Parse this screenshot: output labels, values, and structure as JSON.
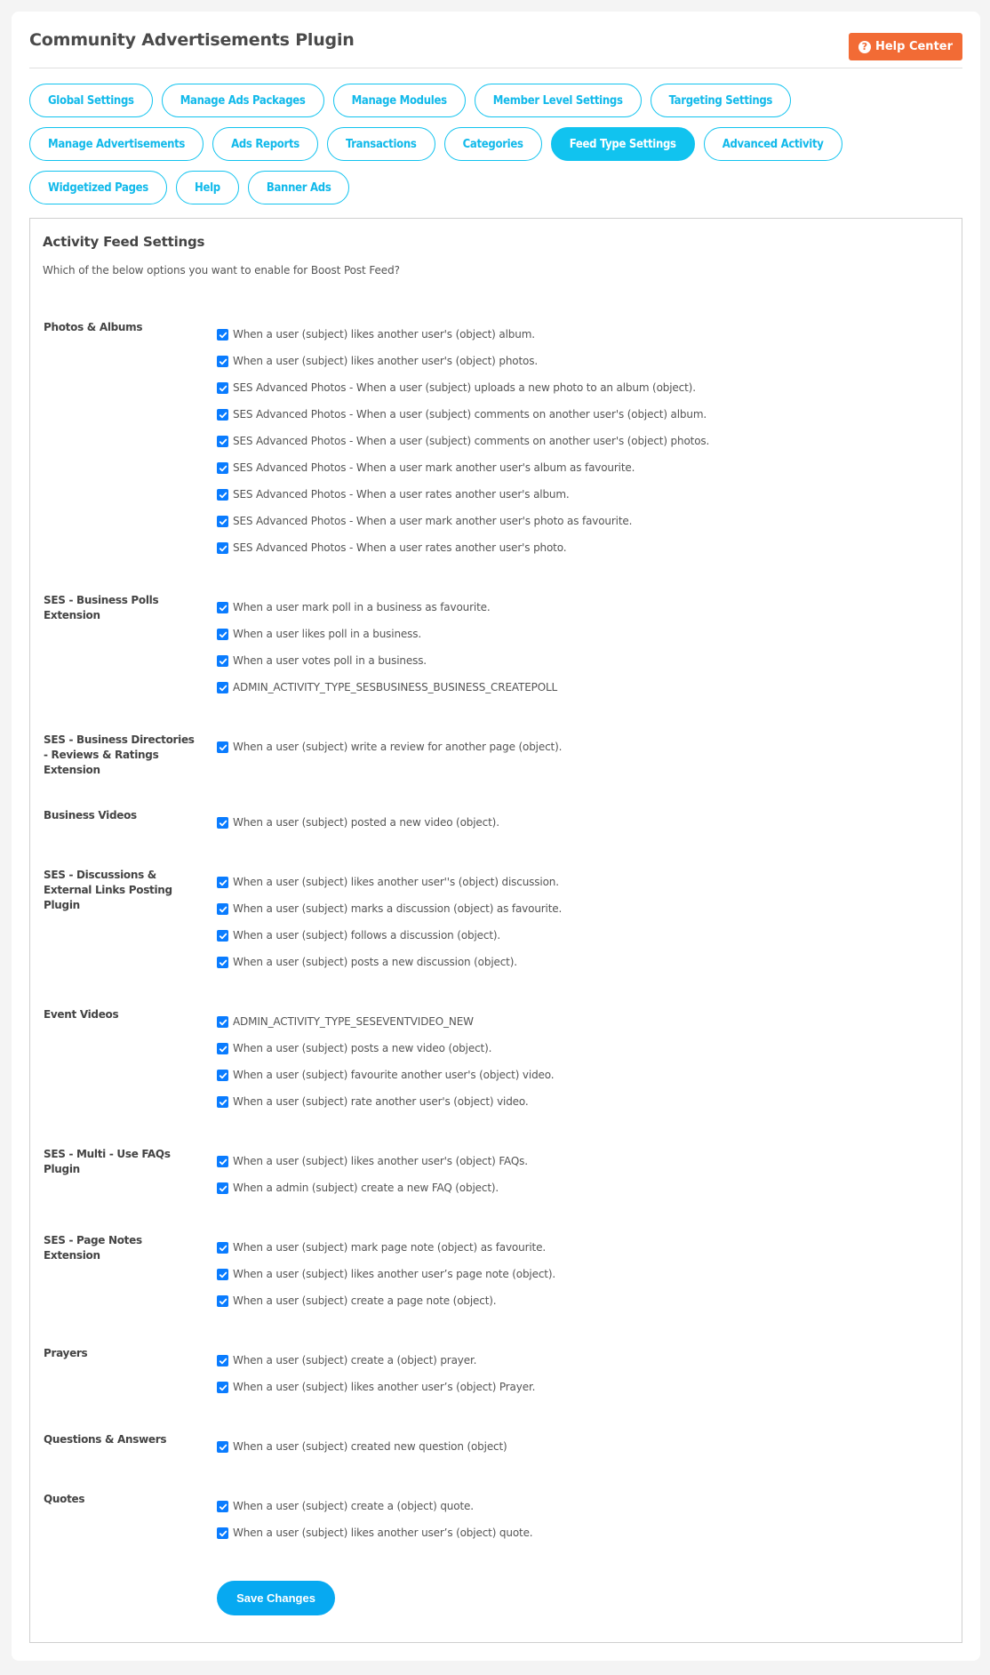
{
  "header": {
    "title": "Community Advertisements Plugin",
    "help_center_label": "Help Center",
    "help_icon": "question-circle-icon"
  },
  "colors": {
    "accent": "#11c3ef",
    "help_button": "#f26b35",
    "save_button": "#07a9f1",
    "checkbox": "#0a7cff"
  },
  "nav": {
    "active": "Feed Type Settings",
    "rows": [
      [
        "Global Settings",
        "Manage Ads Packages",
        "Manage Modules",
        "Member Level Settings",
        "Targeting Settings"
      ],
      [
        "Manage Advertisements",
        "Ads Reports",
        "Transactions",
        "Categories",
        "Feed Type Settings",
        "Advanced Activity"
      ],
      [
        "Widgetized Pages",
        "Help",
        "Banner Ads"
      ]
    ]
  },
  "settings": {
    "title": "Activity Feed Settings",
    "description": "Which of the below options you want to enable for Boost Post Feed?",
    "groups": [
      {
        "label": "Photos & Albums",
        "items": [
          {
            "label": "When a user (subject) likes another user's (object) album.",
            "checked": true
          },
          {
            "label": "When a user (subject) likes another user's (object) photos.",
            "checked": true
          },
          {
            "label": "SES Advanced Photos - When a user (subject) uploads a new photo to an album (object).",
            "checked": true
          },
          {
            "label": "SES Advanced Photos - When a user (subject) comments on another user's (object) album.",
            "checked": true
          },
          {
            "label": "SES Advanced Photos - When a user (subject) comments on another user's (object) photos.",
            "checked": true
          },
          {
            "label": "SES Advanced Photos - When a user mark another user's album as favourite.",
            "checked": true
          },
          {
            "label": "SES Advanced Photos - When a user rates another user's album.",
            "checked": true
          },
          {
            "label": "SES Advanced Photos - When a user mark another user's photo as favourite.",
            "checked": true
          },
          {
            "label": "SES Advanced Photos - When a user rates another user's photo.",
            "checked": true
          }
        ]
      },
      {
        "label": "SES - Business Polls Extension",
        "items": [
          {
            "label": "When a user mark poll in a business as favourite.",
            "checked": true
          },
          {
            "label": "When a user likes poll in a business.",
            "checked": true
          },
          {
            "label": "When a user votes poll in a business.",
            "checked": true
          },
          {
            "label": "ADMIN_ACTIVITY_TYPE_SESBUSINESS_BUSINESS_CREATEPOLL",
            "checked": true
          }
        ]
      },
      {
        "label": "SES - Business Directories - Reviews & Ratings Extension",
        "items": [
          {
            "label": "When a user (subject) write a review for another page (object).",
            "checked": true
          }
        ]
      },
      {
        "label": "Business Videos",
        "items": [
          {
            "label": "When a user (subject) posted a new video (object).",
            "checked": true
          }
        ]
      },
      {
        "label": "SES - Discussions & External Links Posting Plugin",
        "items": [
          {
            "label": "When a user (subject) likes another user''s (object) discussion.",
            "checked": true
          },
          {
            "label": "When a user (subject) marks a discussion (object) as favourite.",
            "checked": true
          },
          {
            "label": "When a user (subject) follows a discussion (object).",
            "checked": true
          },
          {
            "label": "When a user (subject) posts a new discussion (object).",
            "checked": true
          }
        ]
      },
      {
        "label": "Event Videos",
        "items": [
          {
            "label": "ADMIN_ACTIVITY_TYPE_SESEVENTVIDEO_NEW",
            "checked": true
          },
          {
            "label": "When a user (subject) posts a new video (object).",
            "checked": true
          },
          {
            "label": "When a user (subject) favourite another user's (object) video.",
            "checked": true
          },
          {
            "label": "When a user (subject) rate another user's (object) video.",
            "checked": true
          }
        ]
      },
      {
        "label": "SES - Multi - Use FAQs Plugin",
        "items": [
          {
            "label": "When a user (subject) likes another user's (object) FAQs.",
            "checked": true
          },
          {
            "label": "When a admin (subject) create a new FAQ (object).",
            "checked": true
          }
        ]
      },
      {
        "label": "SES - Page Notes Extension",
        "items": [
          {
            "label": "When a user (subject) mark page note (object) as favourite.",
            "checked": true
          },
          {
            "label": "When a user (subject) likes another user’s page note (object).",
            "checked": true
          },
          {
            "label": "When a user (subject) create a page note (object).",
            "checked": true
          }
        ]
      },
      {
        "label": "Prayers",
        "items": [
          {
            "label": "When a user (subject) create a (object) prayer.",
            "checked": true
          },
          {
            "label": "When a user (subject) likes another user’s (object) Prayer.",
            "checked": true
          }
        ]
      },
      {
        "label": "Questions & Answers",
        "items": [
          {
            "label": "When a user (subject) created new question (object)",
            "checked": true
          }
        ]
      },
      {
        "label": "Quotes",
        "items": [
          {
            "label": "When a user (subject) create a (object) quote.",
            "checked": true
          },
          {
            "label": "When a user (subject) likes another user’s (object) quote.",
            "checked": true
          }
        ]
      }
    ],
    "save_label": "Save Changes"
  }
}
